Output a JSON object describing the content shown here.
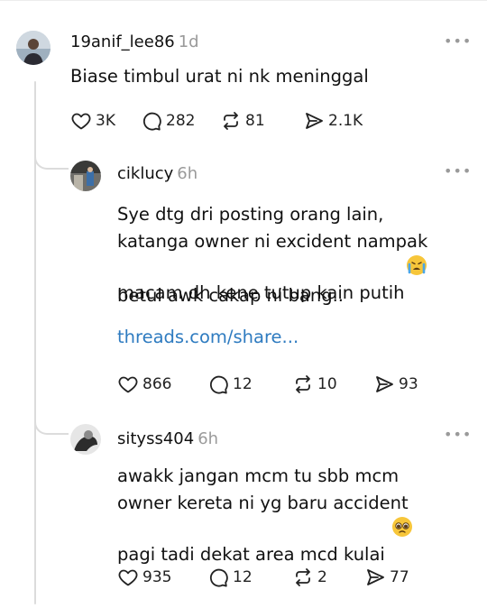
{
  "posts": [
    {
      "username": "19anif_lee86",
      "time": "1d",
      "text": "Biase timbul urat ni nk meninggal",
      "likes": "3K",
      "comments": "282",
      "reposts": "81",
      "shares": "2.1K"
    },
    {
      "username": "ciklucy",
      "time": "6h",
      "text": "Sye dtg dri posting orang lain,\nkatanga owner ni excident nampak\nmacam dh kene tutup kain putih",
      "text2": "betul awk cakap ni bang..",
      "link": "threads.com/share...",
      "likes": "866",
      "comments": "12",
      "reposts": "10",
      "shares": "93"
    },
    {
      "username": "sityss404",
      "time": "6h",
      "text": "awakk jangan mcm tu sbb mcm\nowner kereta ni yg baru accident\npagi tadi dekat area mcd kulai",
      "likes": "935",
      "comments": "12",
      "reposts": "2",
      "shares": "77"
    }
  ],
  "more_label": "•••"
}
